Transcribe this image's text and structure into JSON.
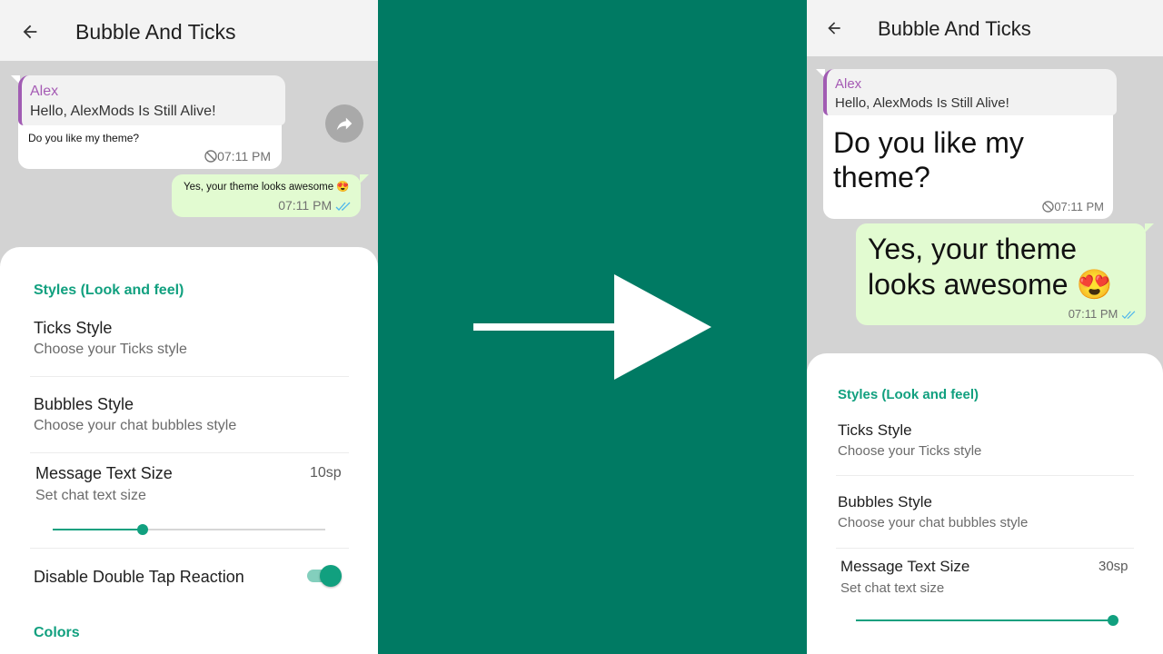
{
  "left": {
    "app_title": "Bubble And Ticks",
    "incoming": {
      "quote_name": "Alex",
      "quote_text": "Hello, AlexMods Is Still Alive!",
      "text": "Do you like my theme?",
      "time": "07:11 PM"
    },
    "outgoing": {
      "text": "Yes, your theme looks awesome 😍",
      "time": "07:11 PM"
    },
    "settings": {
      "section_styles": "Styles (Look and feel)",
      "ticks_title": "Ticks Style",
      "ticks_sub": "Choose your Ticks style",
      "bubbles_title": "Bubbles Style",
      "bubbles_sub": "Choose your chat bubbles style",
      "size_title": "Message Text Size",
      "size_sub": "Set chat text size",
      "size_value": "10sp",
      "size_slider_fraction": 0.33,
      "reaction_title": "Disable Double Tap Reaction",
      "reaction_enabled": true,
      "section_colors": "Colors"
    }
  },
  "right": {
    "app_title": "Bubble And Ticks",
    "incoming": {
      "quote_name": "Alex",
      "quote_text": "Hello, AlexMods Is Still Alive!",
      "text_line1": "Do you like my",
      "text_line2": "theme?",
      "time": "07:11 PM"
    },
    "outgoing": {
      "text_line1": "Yes, your theme",
      "text_line2": "looks awesome 😍",
      "time": "07:11 PM"
    },
    "settings": {
      "section_styles": "Styles (Look and feel)",
      "ticks_title": "Ticks Style",
      "ticks_sub": "Choose your Ticks style",
      "bubbles_title": "Bubbles Style",
      "bubbles_sub": "Choose your chat bubbles style",
      "size_title": "Message Text Size",
      "size_sub": "Set chat text size",
      "size_value": "30sp",
      "size_slider_fraction": 1.0
    }
  },
  "colors": {
    "background": "#007a63",
    "accent": "#11a07f",
    "outgoing_bubble": "#e2fbd1",
    "quote_name": "#a55bb4"
  },
  "icons": [
    "arrow-back-icon",
    "forward-icon",
    "clock-icon",
    "double-tick-icon",
    "right-arrow-icon"
  ]
}
